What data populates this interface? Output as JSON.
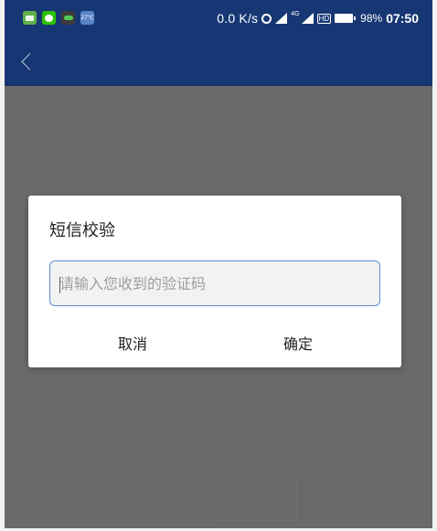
{
  "status_bar": {
    "network_speed": "0.0 K/s",
    "network_type": "4G",
    "hd_label": "HD",
    "battery_percent": "98%",
    "time": "07:50",
    "notification_icons": [
      "message-icon",
      "wechat-icon",
      "owl-icon",
      "weather-icon"
    ],
    "weather_temp": "27℃"
  },
  "app_bar": {
    "back_icon": "chevron-left-icon",
    "color": "#173774"
  },
  "dialog": {
    "title": "短信校验",
    "input_placeholder": "请输入您收到的验证码",
    "input_value": "",
    "cancel_label": "取消",
    "confirm_label": "确定"
  },
  "colors": {
    "overlay": "#6a6a6a",
    "input_border": "#5b8fd6",
    "dialog_bg": "#ffffff"
  }
}
